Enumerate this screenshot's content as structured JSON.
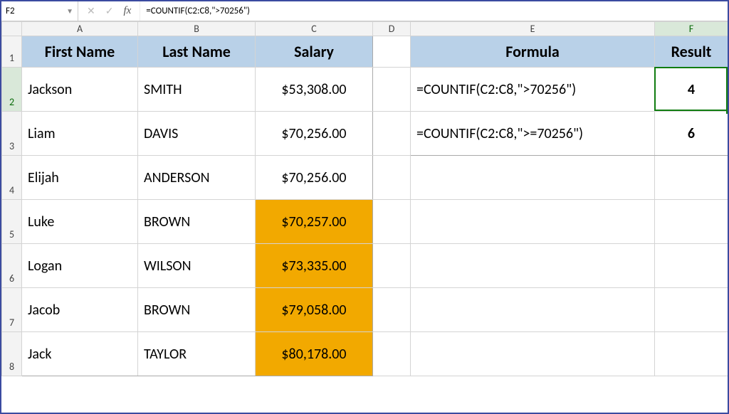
{
  "nameBox": {
    "value": "F2"
  },
  "formulaBar": {
    "cancelIcon": "✕",
    "enterIcon": "✓",
    "fxLabel": "fx",
    "formula": "=COUNTIF(C2:C8,\">70256\")"
  },
  "columns": [
    "A",
    "B",
    "C",
    "D",
    "E",
    "F"
  ],
  "rows": [
    "1",
    "2",
    "3",
    "4",
    "5",
    "6",
    "7",
    "8"
  ],
  "activeColumn": "F",
  "activeRow": "2",
  "headers": {
    "a1": "First Name",
    "b1": "Last Name",
    "c1": "Salary",
    "e1": "Formula",
    "f1": "Result"
  },
  "people": [
    {
      "first": "Jackson",
      "last": "SMITH",
      "salary": "$53,308.00",
      "hl": false
    },
    {
      "first": "Liam",
      "last": "DAVIS",
      "salary": "$70,256.00",
      "hl": false
    },
    {
      "first": "Elijah",
      "last": "ANDERSON",
      "salary": "$70,256.00",
      "hl": false
    },
    {
      "first": "Luke",
      "last": "BROWN",
      "salary": "$70,257.00",
      "hl": true
    },
    {
      "first": "Logan",
      "last": "WILSON",
      "salary": "$73,335.00",
      "hl": true
    },
    {
      "first": "Jacob",
      "last": "BROWN",
      "salary": "$79,058.00",
      "hl": true
    },
    {
      "first": "Jack",
      "last": "TAYLOR",
      "salary": "$80,178.00",
      "hl": true
    }
  ],
  "formulas": [
    {
      "text": "=COUNTIF(C2:C8,\">70256\")",
      "result": "4"
    },
    {
      "text": "=COUNTIF(C2:C8,\">=70256\")",
      "result": "6"
    }
  ],
  "activeCell": {
    "col": "F",
    "row": 2
  }
}
